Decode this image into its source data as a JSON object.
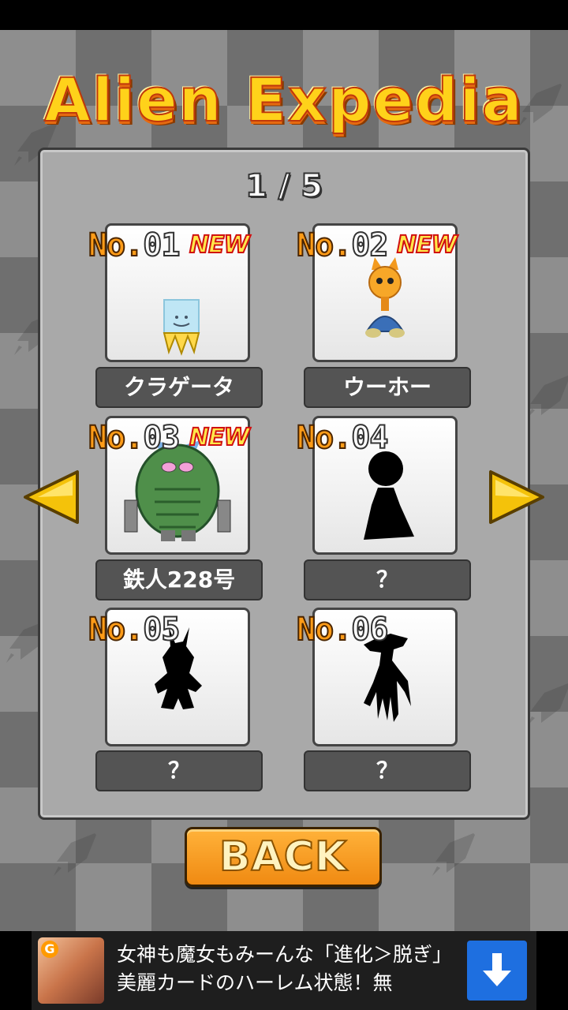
{
  "title": "Alien Expedia",
  "page_indicator": "1 / 5",
  "cards": [
    {
      "prefix": "No.",
      "number": "01",
      "badge": "NEW",
      "name": "クラゲータ",
      "discovered": true,
      "icon": "jellyfish-alien"
    },
    {
      "prefix": "No.",
      "number": "02",
      "badge": "NEW",
      "name": "ウーホー",
      "discovered": true,
      "icon": "orange-cat-alien"
    },
    {
      "prefix": "No.",
      "number": "03",
      "badge": "NEW",
      "name": "鉄人228号",
      "discovered": true,
      "icon": "green-robot-alien"
    },
    {
      "prefix": "No.",
      "number": "04",
      "badge": "",
      "name": "？",
      "discovered": false,
      "icon": "unknown-silhouette"
    },
    {
      "prefix": "No.",
      "number": "05",
      "badge": "",
      "name": "？",
      "discovered": false,
      "icon": "unknown-silhouette"
    },
    {
      "prefix": "No.",
      "number": "06",
      "badge": "",
      "name": "？",
      "discovered": false,
      "icon": "unknown-silhouette"
    }
  ],
  "nav": {
    "prev_icon": "left-arrow-icon",
    "next_icon": "right-arrow-icon"
  },
  "back_label": "BACK",
  "ad": {
    "text": "女神も魔女もみーんな「進化＞脱ぎ」 美麗カードのハーレム状態！無",
    "icon": "download-icon",
    "thumb_letter": "G"
  },
  "colors": {
    "accent": "#ff9c18",
    "title": "#ffd21a",
    "new_badge": "#d01010",
    "ad_button": "#1e6fe0"
  }
}
